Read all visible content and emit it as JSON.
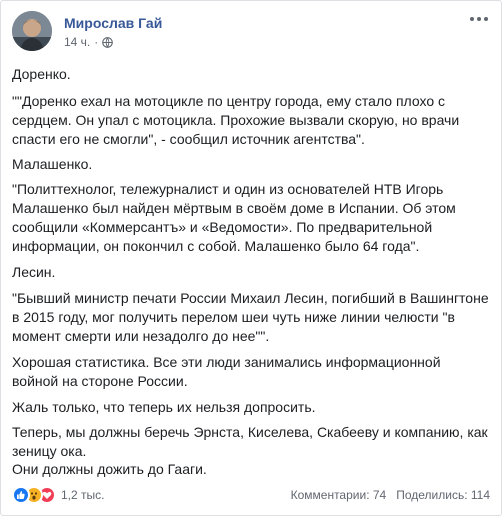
{
  "post": {
    "author": "Мирослав Гай",
    "time": "14 ч.",
    "paragraphs": [
      "Доренко.",
      "\"\"Доренко ехал на мотоцикле по центру города, ему стало плохо с сердцем. Он упал с мотоцикла. Прохожие вызвали скорую, но врачи спасти его не смогли\", - сообщил источник агентства\".",
      "Малашенко.",
      "\"Политтехнолог, тележурналист и один из основателей НТВ Игорь Малашенко был найден мёртвым в своём доме в Испании. Об этом сообщили «Коммерсантъ» и «Ведомости». По предварительной информации, он покончил с собой. Малашенко было 64 года\".",
      "Лесин.",
      "\"Бывший министр печати России Михаил Лесин, погибший в Вашингтоне в 2015 году, мог получить перелом шеи чуть ниже линии челюсти \"в момент смерти или незадолго до нее\"\".",
      "Хорошая статистика. Все эти люди занимались информационной войной на стороне России.",
      "Жаль только, что теперь их нельзя допросить.",
      "Теперь, мы должны беречь Эрнста, Киселева, Скабееву и компанию, как зеницу ока.",
      "Они должны дожить до Гааги."
    ]
  },
  "footer": {
    "reactions_count": "1,2 тыс.",
    "comments": "Комментарии: 74",
    "shares": "Поделились: 114"
  },
  "icons": {
    "reactions": [
      "like-icon",
      "wow-icon",
      "love-icon"
    ],
    "privacy": "globe-icon",
    "menu": "more-options-icon"
  },
  "colors": {
    "author": "#385898",
    "like": "#1877f2",
    "love": "#f33e58",
    "wow": "#f7b125"
  }
}
